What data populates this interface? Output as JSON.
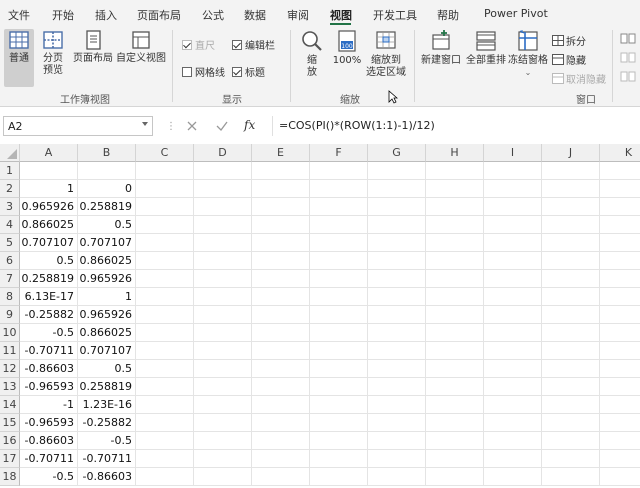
{
  "tabs": [
    "文件",
    "开始",
    "插入",
    "页面布局",
    "公式",
    "数据",
    "审阅",
    "视图",
    "开发工具",
    "帮助",
    "Power Pivot"
  ],
  "active_tab": "视图",
  "ribbon": {
    "workbook_views": {
      "normal": "普通",
      "page_break_preview": "分页\n预览",
      "page_layout": "页面布局",
      "custom_views": "自定义视图",
      "group_label": "工作簿视图"
    },
    "show": {
      "ruler": "直尺",
      "formula_bar": "编辑栏",
      "gridlines": "网格线",
      "headings": "标题",
      "group_label": "显示"
    },
    "zoom": {
      "zoom": "缩\n放",
      "zoom_100": "100%",
      "zoom_to_selection": "缩放到\n选定区域",
      "group_label": "缩放"
    },
    "window": {
      "new_window": "新建窗口",
      "arrange_all": "全部重排",
      "freeze_panes": "冻结窗格",
      "split": "拆分",
      "hide": "隐藏",
      "unhide": "取消隐藏",
      "group_label": "窗口"
    }
  },
  "formula_bar": {
    "name_box": "A2",
    "fx": "fx",
    "formula": "=COS(PI()*(ROW(1:1)-1)/12)"
  },
  "sheet": {
    "columns": [
      "A",
      "B",
      "C",
      "D",
      "E",
      "F",
      "G",
      "H",
      "I",
      "J",
      "K"
    ],
    "row_numbers": [
      "1",
      "2",
      "3",
      "4",
      "5",
      "6",
      "7",
      "8",
      "9",
      "10",
      "11",
      "12",
      "13",
      "14",
      "15",
      "16",
      "17",
      "18"
    ],
    "rows": [
      [
        "",
        ""
      ],
      [
        "1",
        "0"
      ],
      [
        "0.965926",
        "0.258819"
      ],
      [
        "0.866025",
        "0.5"
      ],
      [
        "0.707107",
        "0.707107"
      ],
      [
        "0.5",
        "0.866025"
      ],
      [
        "0.258819",
        "0.965926"
      ],
      [
        "6.13E-17",
        "1"
      ],
      [
        "-0.25882",
        "0.965926"
      ],
      [
        "-0.5",
        "0.866025"
      ],
      [
        "-0.70711",
        "0.707107"
      ],
      [
        "-0.86603",
        "0.5"
      ],
      [
        "-0.96593",
        "0.258819"
      ],
      [
        "-1",
        "1.23E-16"
      ],
      [
        "-0.96593",
        "-0.25882"
      ],
      [
        "-0.86603",
        "-0.5"
      ],
      [
        "-0.70711",
        "-0.70711"
      ],
      [
        "-0.5",
        "-0.86603"
      ]
    ]
  },
  "colors": {
    "accent": "#217346",
    "header_bg": "#f0f0f0",
    "ribbon_bg": "#f3f3f3"
  }
}
